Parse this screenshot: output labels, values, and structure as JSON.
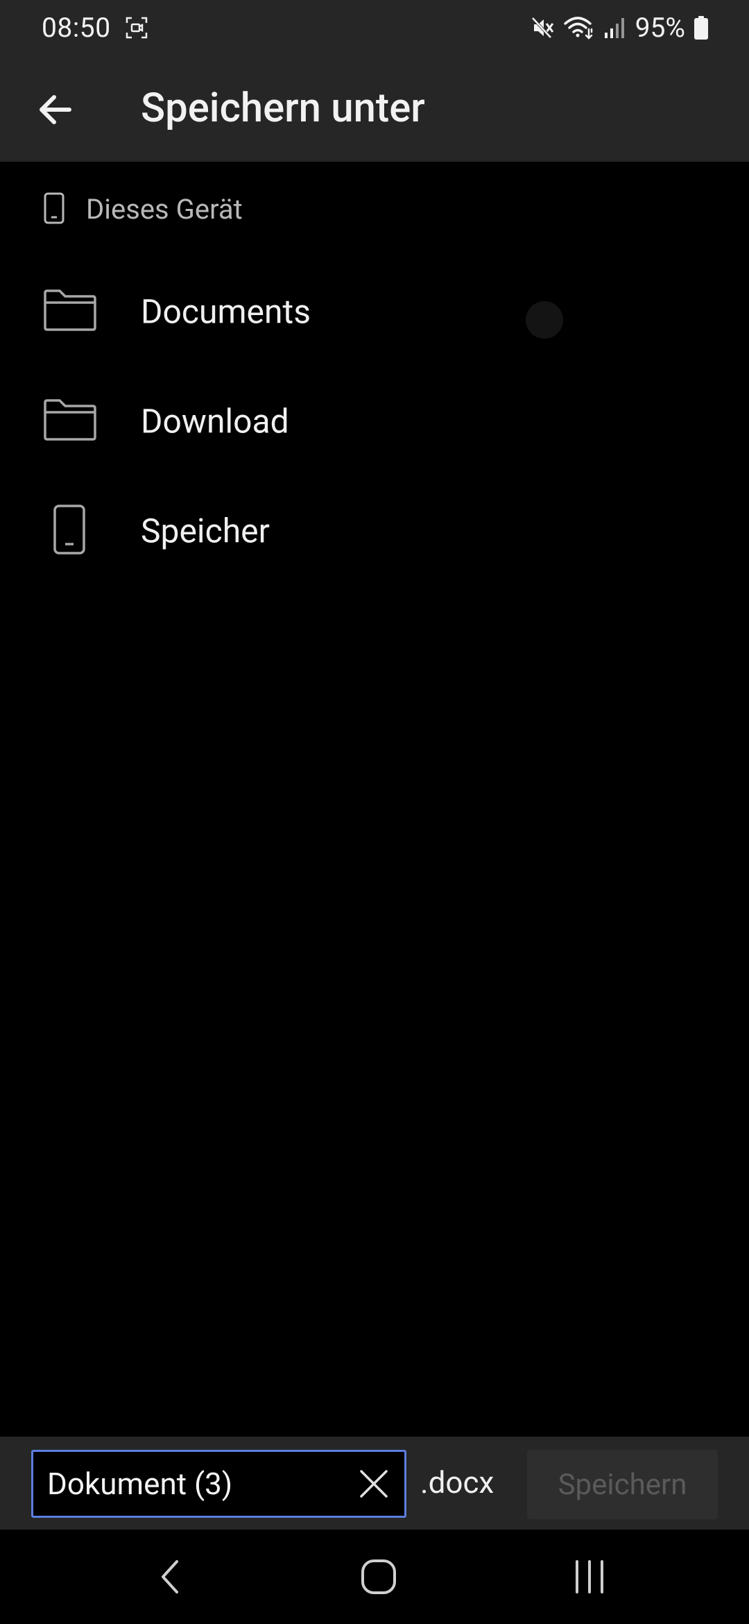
{
  "status_bar": {
    "time": "08:50",
    "battery_percent": "95%",
    "icons": [
      "screen-record-icon",
      "mute-icon",
      "wifi-icon",
      "signal-icon",
      "battery-icon"
    ]
  },
  "app_bar": {
    "title": "Speichern unter",
    "back_icon": "arrow-left-icon"
  },
  "location": {
    "label": "Dieses Gerät",
    "icon": "phone-icon"
  },
  "items": [
    {
      "label": "Documents",
      "icon": "folder-icon"
    },
    {
      "label": "Download",
      "icon": "folder-icon"
    },
    {
      "label": "Speicher",
      "icon": "phone-icon"
    }
  ],
  "save_bar": {
    "filename": "Dokument (3)",
    "extension": ".docx",
    "save_label": "Speichern",
    "save_enabled": false
  },
  "colors": {
    "background": "#000000",
    "bar": "#262626",
    "accent_border": "#5c7fe0",
    "disabled_text": "#5a5a5a"
  }
}
